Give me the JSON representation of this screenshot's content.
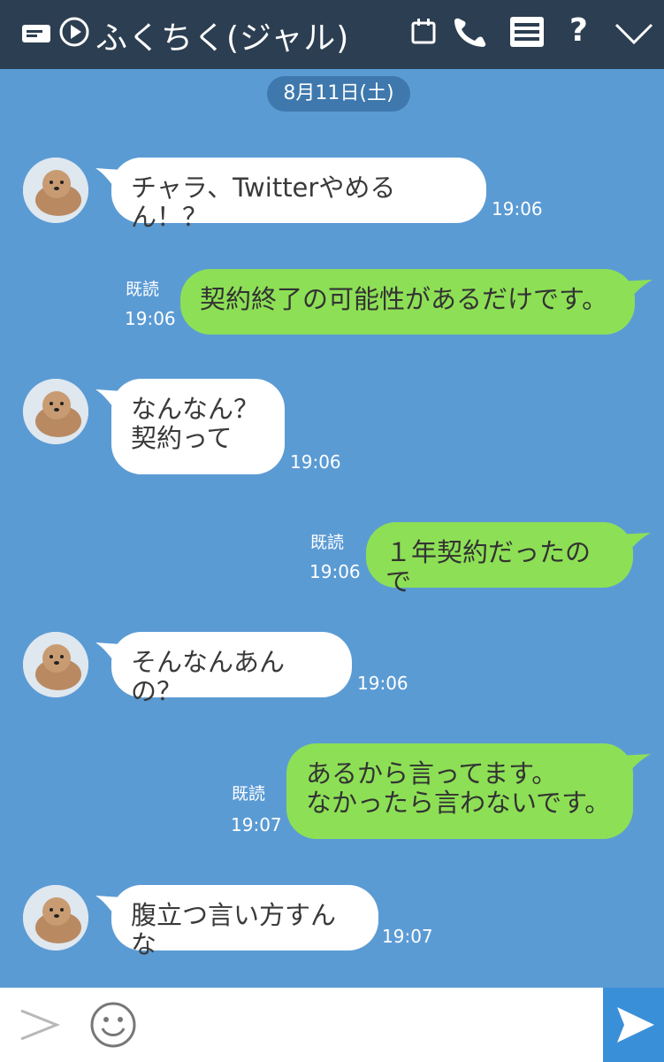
{
  "header": {
    "title": "ふくちく(ジャル)",
    "icons": [
      "keyboard-icon",
      "play-icon",
      "calendar-icon",
      "phone-icon",
      "menu-icon",
      "help-icon",
      "chevron-down-icon"
    ]
  },
  "date_label": "8月11日(土)",
  "messages": [
    {
      "side": "in",
      "text": "チャラ、Twitterやめるん！？",
      "time": "19:06"
    },
    {
      "side": "out",
      "text": "契約終了の可能性があるだけです。",
      "time": "19:06",
      "read": "既読"
    },
    {
      "side": "in",
      "text": "なんなん？\n契約って",
      "time": "19:06"
    },
    {
      "side": "out",
      "text": "１年契約だったので",
      "time": "19:06",
      "read": "既読"
    },
    {
      "side": "in",
      "text": "そんなんあんの？",
      "time": "19:06"
    },
    {
      "side": "out",
      "text": "あるから言ってます。\nなかったら言わないです。",
      "time": "19:07",
      "read": "既読"
    },
    {
      "side": "in",
      "text": "腹立つ言い方すんな",
      "time": "19:07"
    }
  ],
  "footer": {
    "icons": [
      "expand-icon",
      "emoji-icon",
      "send-icon"
    ]
  },
  "colors": {
    "header_bg": "#2c3e51",
    "chat_bg": "#5b9bd4",
    "bubble_out": "#8de055",
    "bubble_in": "#ffffff",
    "send_bg": "#3a8fd9"
  }
}
